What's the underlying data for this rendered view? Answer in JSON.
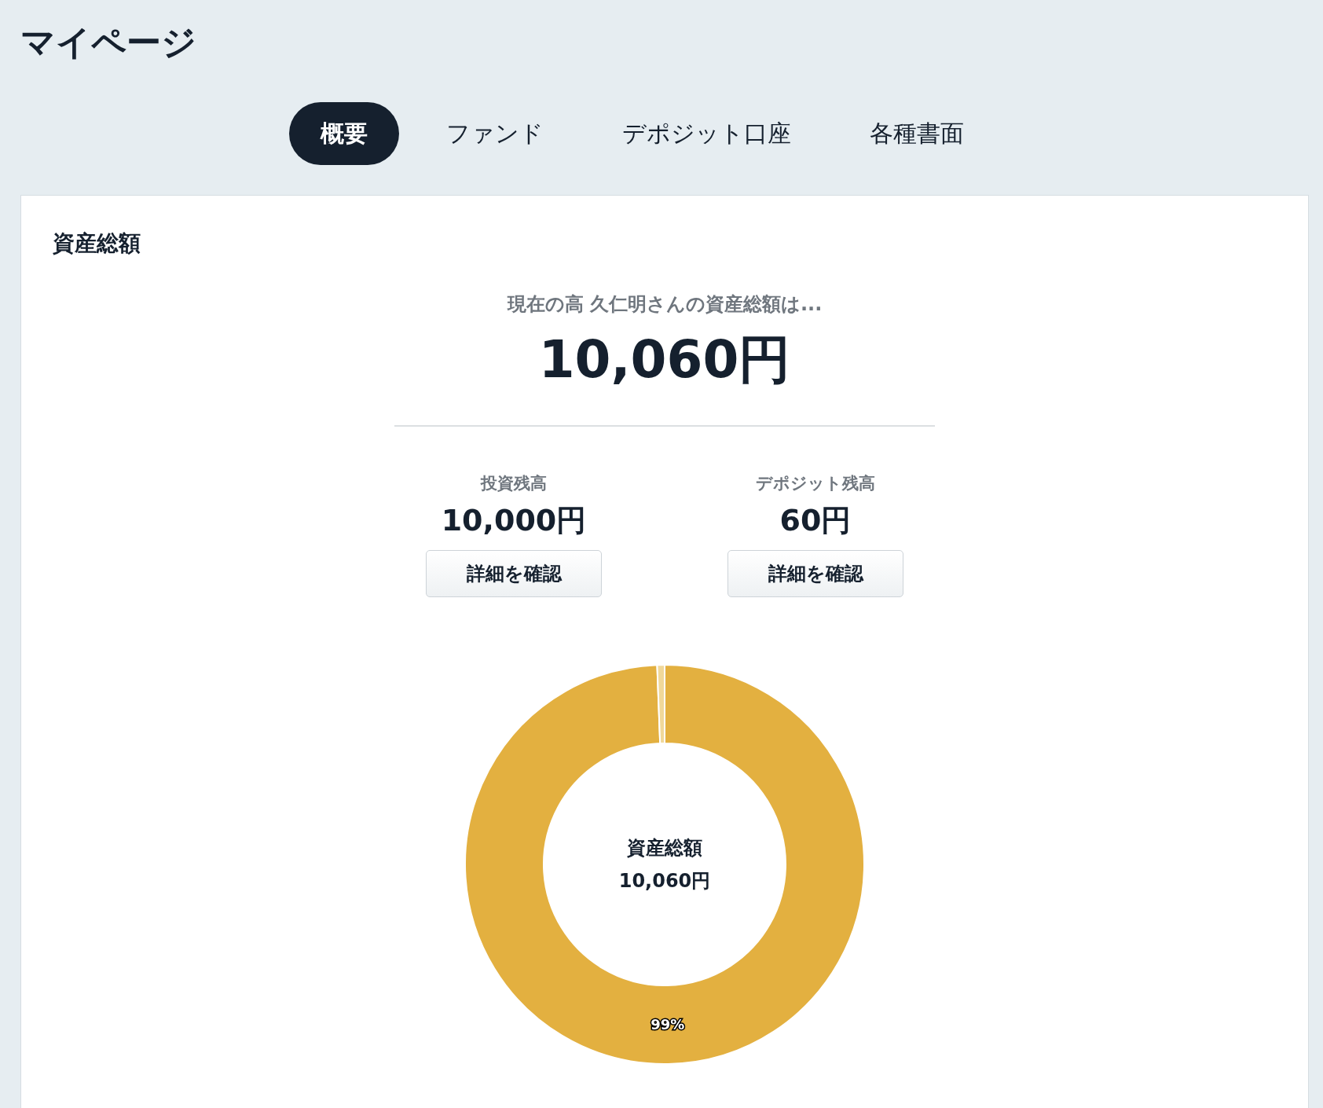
{
  "page_title": "マイページ",
  "tabs": [
    {
      "label": "概要",
      "selected": true
    },
    {
      "label": "ファンド",
      "selected": false
    },
    {
      "label": "デポジット口座",
      "selected": false
    },
    {
      "label": "各種書面",
      "selected": false
    }
  ],
  "card": {
    "heading": "資産総額",
    "intro": "現在の高 久仁明さんの資産総額は...",
    "total": "10,060円",
    "balances": [
      {
        "label": "投資残高",
        "amount": "10,000円",
        "button": "詳細を確認"
      },
      {
        "label": "デポジット残高",
        "amount": "60円",
        "button": "詳細を確認"
      }
    ],
    "donut": {
      "center_label": "資産総額",
      "center_value": "10,060円",
      "chart_data": {
        "type": "donut",
        "values": [
          99.4,
          0.6
        ],
        "colors": [
          "#e3b040",
          "#f0d89a"
        ],
        "value_labels": [
          "99%",
          null
        ]
      }
    }
  }
}
